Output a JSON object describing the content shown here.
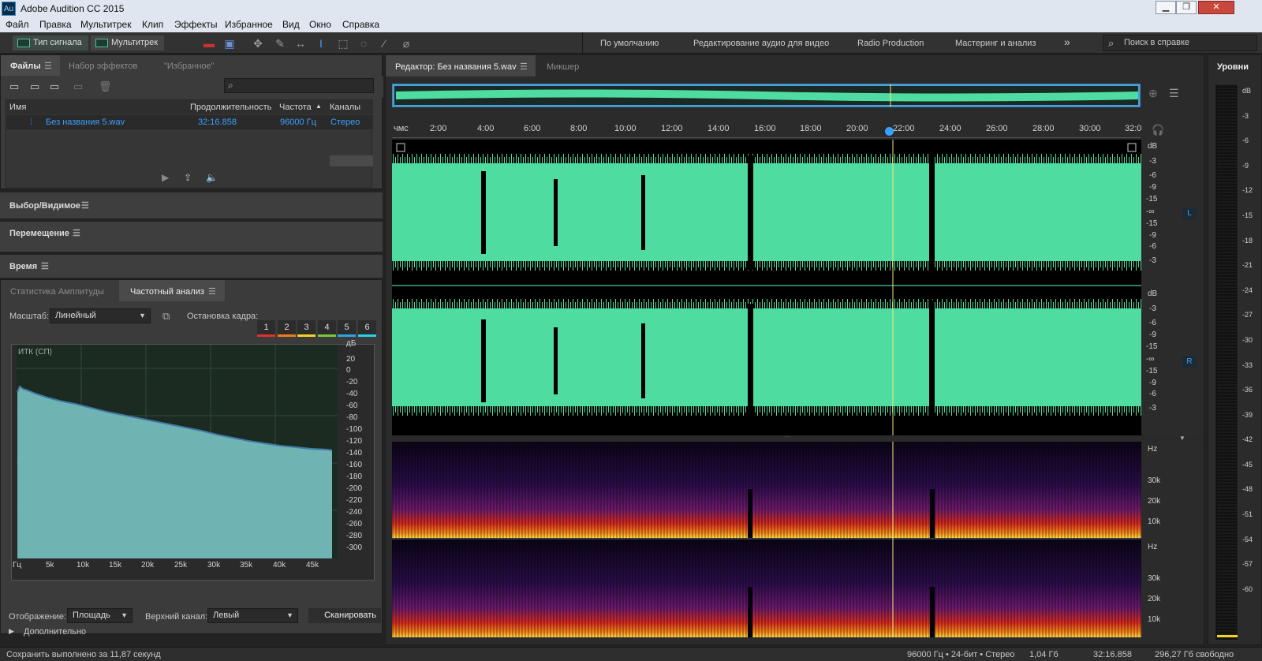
{
  "window": {
    "title": "Adobe Audition CC 2015",
    "logo": "Au",
    "btn_min": "▁",
    "btn_max": "❐",
    "btn_close": "✕"
  },
  "menu": [
    "Файл",
    "Правка",
    "Мультитрек",
    "Клип",
    "Эффекты",
    "Избранное",
    "Вид",
    "Окно",
    "Справка"
  ],
  "toolbar": {
    "mode_waveform": "Тип сигнала",
    "mode_multitrack": "Мультитрек",
    "workspaces": [
      "По умолчанию",
      "Редактирование аудио для видео",
      "Radio Production",
      "Мастеринг и анализ"
    ],
    "more": "»",
    "search_placeholder": "Поиск в справке"
  },
  "files_panel": {
    "tabs": [
      "Файлы",
      "Набор эффектов",
      "\"Избранное\""
    ],
    "columns": [
      "Имя",
      "Продолжительность",
      "Частота",
      "Каналы"
    ],
    "rows": [
      {
        "name": "Без названия 5.wav",
        "duration": "32:16.858",
        "rate": "96000 Гц",
        "channels": "Стерео"
      }
    ]
  },
  "sections": [
    "Выбор/Видимое",
    "Перемещение",
    "Время"
  ],
  "analysis": {
    "tabs": [
      "Статистика Амплитуды",
      "Частотный анализ"
    ],
    "scale_label": "Масштаб:",
    "scale_value": "Линейный",
    "freeze_label": "Остановка кадра:",
    "frames": [
      "1",
      "2",
      "3",
      "4",
      "5",
      "6"
    ],
    "frame_colors": [
      "#e0312a",
      "#f07a1c",
      "#f2d321",
      "#7ac73a",
      "#2aa7e0",
      "#2ad1e8"
    ],
    "plot_label": "ИТК (СП)",
    "db_unit": "дБ",
    "db_ticks": [
      "20",
      "0",
      "-20",
      "-40",
      "-60",
      "-80",
      "-100",
      "-120",
      "-140",
      "-160",
      "-180",
      "-200",
      "-220",
      "-240",
      "-260",
      "-280",
      "-300"
    ],
    "freq_ticks": [
      "Гц",
      "5k",
      "10k",
      "15k",
      "20k",
      "25k",
      "30k",
      "35k",
      "40k",
      "45k"
    ],
    "display_label": "Отображение:",
    "display_value": "Площадь",
    "channel_label": "Верхний канал:",
    "channel_value": "Левый",
    "scan_button": "Сканировать",
    "advanced": "Дополнительно"
  },
  "editor": {
    "tab_editor": "Редактор: Без названия 5.wav",
    "tab_mixer": "Микшер",
    "timeline_unit": "чмс",
    "time_ticks": [
      "2:00",
      "4:00",
      "6:00",
      "8:00",
      "10:00",
      "12:00",
      "14:00",
      "16:00",
      "18:00",
      "20:00",
      "22:00",
      "24:00",
      "26:00",
      "28:00",
      "30:00",
      "32:0"
    ],
    "db_labels": [
      "dB",
      "-3",
      "-6",
      "-9",
      "-15",
      "-∞",
      "-15",
      "-9",
      "-6",
      "-3"
    ],
    "channel_L": "L",
    "channel_R": "R",
    "hz_labels": [
      "Hz",
      "30k",
      "20k",
      "10k"
    ]
  },
  "levels": {
    "title": "Уровни",
    "ticks": [
      "dB",
      "-3",
      "-6",
      "-9",
      "-12",
      "-15",
      "-18",
      "-21",
      "-24",
      "-27",
      "-30",
      "-33",
      "-36",
      "-39",
      "-42",
      "-45",
      "-48",
      "-51",
      "-54",
      "-57",
      "-60"
    ]
  },
  "status": {
    "save": "Сохранить выполнено за 11,87 секунд",
    "format": "96000 Гц • 24-бит • Стерео",
    "size": "1,04 Гб",
    "duration": "32:16.858",
    "free": "296,27 Гб свободно"
  },
  "colors": {
    "waveform": "#4fdca0",
    "spectrum_fill": "#6fb3b3",
    "playhead": "#f5e67a",
    "accent": "#3aa0ff"
  }
}
